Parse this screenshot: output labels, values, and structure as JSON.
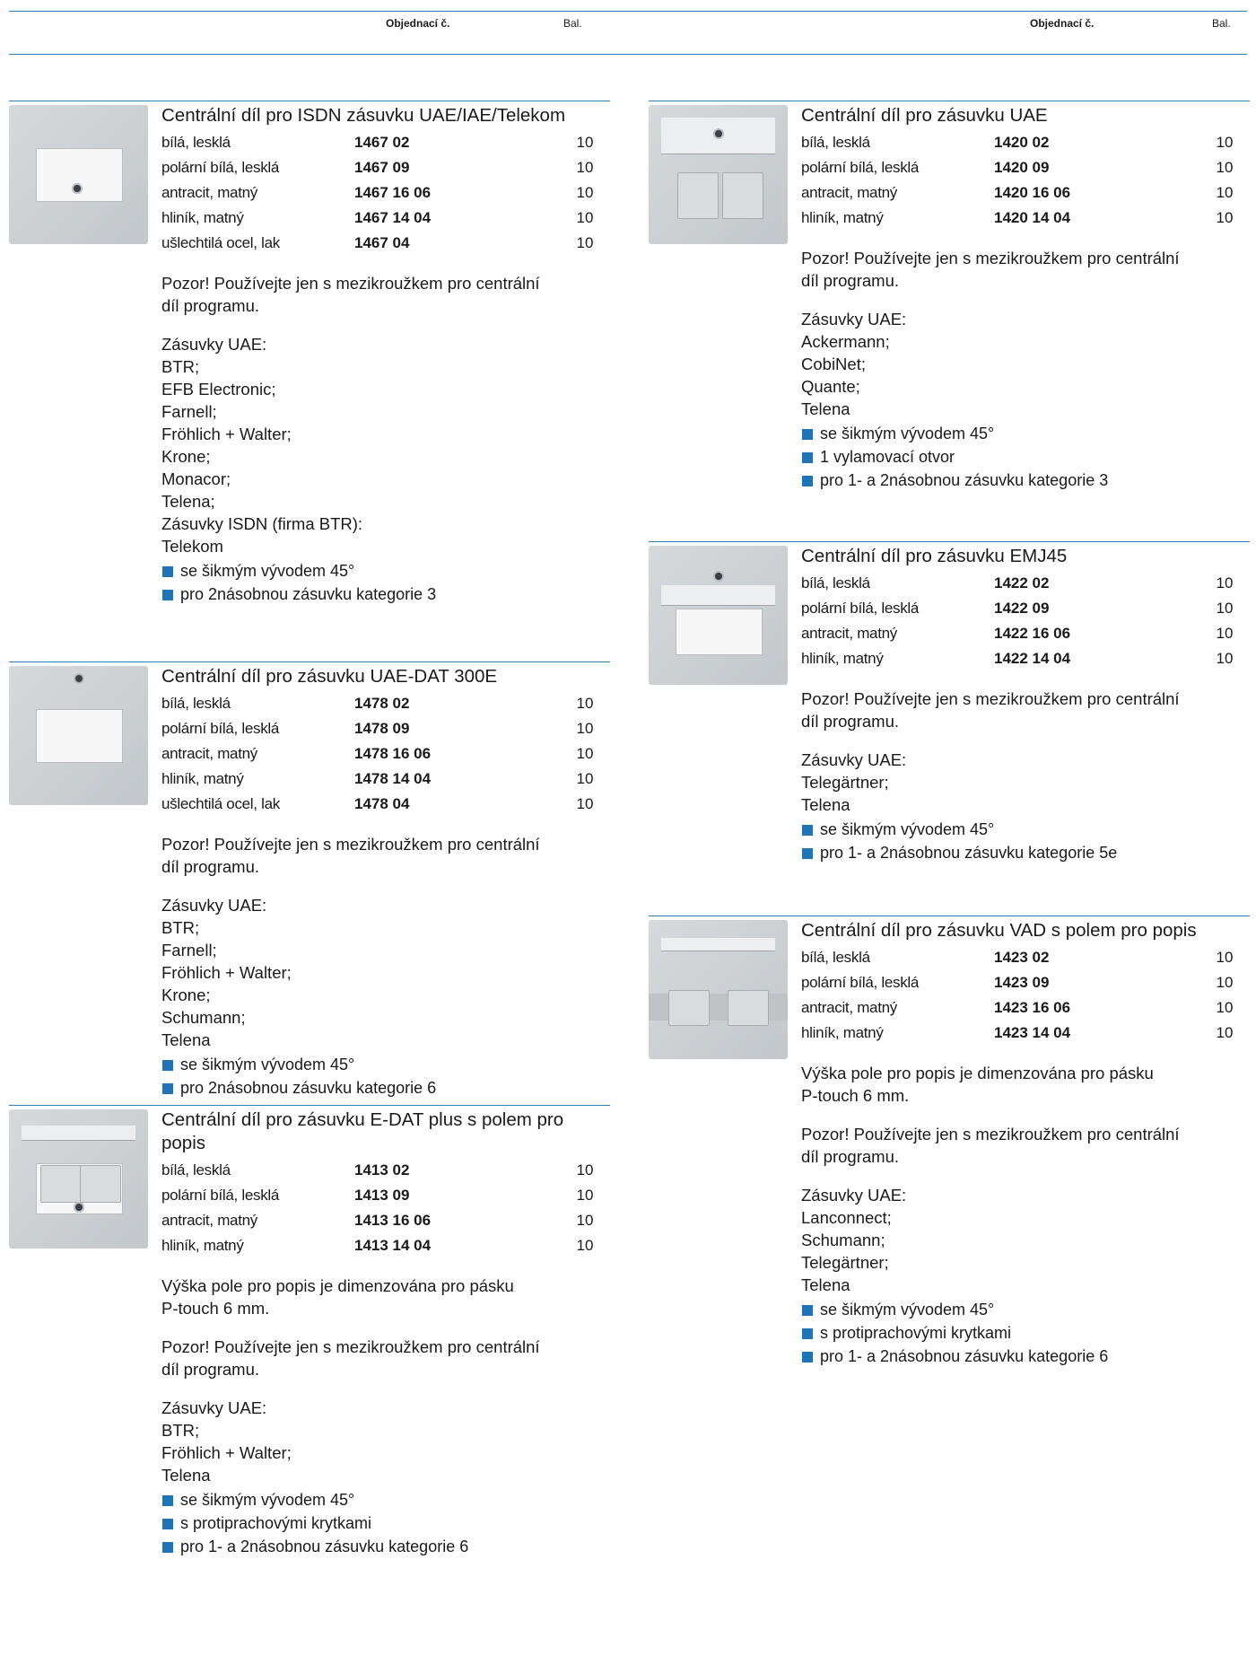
{
  "header": {
    "left": {
      "order_label": "Objednací č.",
      "pack_label": "Bal."
    },
    "right": {
      "order_label": "Objednací č.",
      "pack_label": "Bal."
    }
  },
  "left_column": [
    {
      "title": "Centrální díl pro ISDN zásuvku UAE/IAE/Telekom",
      "variants": [
        {
          "name": "bílá, lesklá",
          "number": "1467 02",
          "qty": "10"
        },
        {
          "name": "polární bílá, lesklá",
          "number": "1467 09",
          "qty": "10"
        },
        {
          "name": "antracit, matný",
          "number": "1467 16 06",
          "qty": "10"
        },
        {
          "name": "hliník, matný",
          "number": "1467 14 04",
          "qty": "10"
        },
        {
          "name": "ušlechtilá ocel, lak",
          "number": "1467 04",
          "qty": "10"
        }
      ],
      "note_lines": [
        "Pozor! Používejte jen s mezikroužkem pro centrální",
        "díl programu."
      ],
      "sockets_lines": [
        "Zásuvky UAE:",
        "BTR;",
        "EFB Electronic;",
        "Farnell;",
        "Fröhlich + Walter;",
        "Krone;",
        "Monacor;",
        "Telena;",
        "Zásuvky ISDN (firma BTR):",
        "Telekom"
      ],
      "bullets": [
        "se šikmým vývodem 45°",
        "pro 2násobnou zásuvku kategorie 3"
      ]
    },
    {
      "title": "Centrální díl pro zásuvku UAE-DAT 300E",
      "variants": [
        {
          "name": "bílá, lesklá",
          "number": "1478 02",
          "qty": "10"
        },
        {
          "name": "polární bílá, lesklá",
          "number": "1478 09",
          "qty": "10"
        },
        {
          "name": "antracit, matný",
          "number": "1478 16 06",
          "qty": "10"
        },
        {
          "name": "hliník, matný",
          "number": "1478 14 04",
          "qty": "10"
        },
        {
          "name": "ušlechtilá ocel, lak",
          "number": "1478 04",
          "qty": "10"
        }
      ],
      "note_lines": [
        "Pozor! Používejte jen s mezikroužkem pro centrální",
        "díl programu."
      ],
      "sockets_lines": [
        "Zásuvky UAE:",
        "BTR;",
        "Farnell;",
        "Fröhlich + Walter;",
        "Krone;",
        "Schumann;",
        "Telena"
      ],
      "bullets": [
        "se šikmým vývodem 45°",
        "pro 2násobnou zásuvku kategorie 6"
      ]
    },
    {
      "title": "Centrální díl pro zásuvku E-DAT plus s polem pro popis",
      "variants": [
        {
          "name": "bílá, lesklá",
          "number": "1413 02",
          "qty": "10"
        },
        {
          "name": "polární bílá, lesklá",
          "number": "1413 09",
          "qty": "10"
        },
        {
          "name": "antracit, matný",
          "number": "1413 16 06",
          "qty": "10"
        },
        {
          "name": "hliník, matný",
          "number": "1413 14 04",
          "qty": "10"
        }
      ],
      "label_lines": [
        "Výška pole pro popis je dimenzována pro pásku",
        "P-touch 6 mm."
      ],
      "note_lines": [
        "Pozor! Používejte jen s mezikroužkem pro centrální",
        "díl programu."
      ],
      "sockets_lines": [
        "Zásuvky UAE:",
        "BTR;",
        "Fröhlich + Walter;",
        "Telena"
      ],
      "bullets": [
        "se šikmým vývodem 45°",
        "s protiprachovými krytkami",
        "pro 1- a 2násobnou zásuvku kategorie 6"
      ]
    }
  ],
  "right_column": [
    {
      "title": "Centrální díl pro zásuvku UAE",
      "variants": [
        {
          "name": "bílá, lesklá",
          "number": "1420 02",
          "qty": "10"
        },
        {
          "name": "polární bílá, lesklá",
          "number": "1420 09",
          "qty": "10"
        },
        {
          "name": "antracit, matný",
          "number": "1420 16 06",
          "qty": "10"
        },
        {
          "name": "hliník, matný",
          "number": "1420 14 04",
          "qty": "10"
        }
      ],
      "note_lines": [
        "Pozor! Používejte jen s mezikroužkem pro centrální",
        "díl programu."
      ],
      "sockets_lines": [
        "Zásuvky UAE:",
        "Ackermann;",
        "CobiNet;",
        "Quante;",
        "Telena"
      ],
      "bullets": [
        "se šikmým vývodem 45°",
        "1 vylamovací otvor",
        "pro 1- a 2násobnou zásuvku kategorie 3"
      ]
    },
    {
      "title": "Centrální díl pro zásuvku EMJ45",
      "variants": [
        {
          "name": "bílá, lesklá",
          "number": "1422 02",
          "qty": "10"
        },
        {
          "name": "polární bílá, lesklá",
          "number": "1422 09",
          "qty": "10"
        },
        {
          "name": "antracit, matný",
          "number": "1422 16 06",
          "qty": "10"
        },
        {
          "name": "hliník, matný",
          "number": "1422 14 04",
          "qty": "10"
        }
      ],
      "note_lines": [
        "Pozor! Používejte jen s mezikroužkem pro centrální",
        "díl programu."
      ],
      "sockets_lines": [
        "Zásuvky UAE:",
        "Telegärtner;",
        "Telena"
      ],
      "bullets": [
        "se šikmým vývodem 45°",
        "pro 1- a 2násobnou zásuvku kategorie 5e"
      ]
    },
    {
      "title": "Centrální díl pro zásuvku VAD s polem pro popis",
      "variants": [
        {
          "name": "bílá, lesklá",
          "number": "1423 02",
          "qty": "10"
        },
        {
          "name": "polární bílá, lesklá",
          "number": "1423 09",
          "qty": "10"
        },
        {
          "name": "antracit, matný",
          "number": "1423 16 06",
          "qty": "10"
        },
        {
          "name": "hliník, matný",
          "number": "1423 14 04",
          "qty": "10"
        }
      ],
      "label_lines": [
        "Výška pole pro popis je dimenzována pro pásku",
        "P-touch 6 mm."
      ],
      "note_lines": [
        "Pozor! Používejte jen s mezikroužkem pro centrální",
        "díl programu."
      ],
      "sockets_lines": [
        "Zásuvky UAE:",
        "Lanconnect;",
        "Schumann;",
        "Telegärtner;",
        "Telena"
      ],
      "bullets": [
        "se šikmým vývodem 45°",
        "s protiprachovými krytkami",
        "pro 1- a 2násobnou zásuvku kategorie 6"
      ]
    }
  ]
}
